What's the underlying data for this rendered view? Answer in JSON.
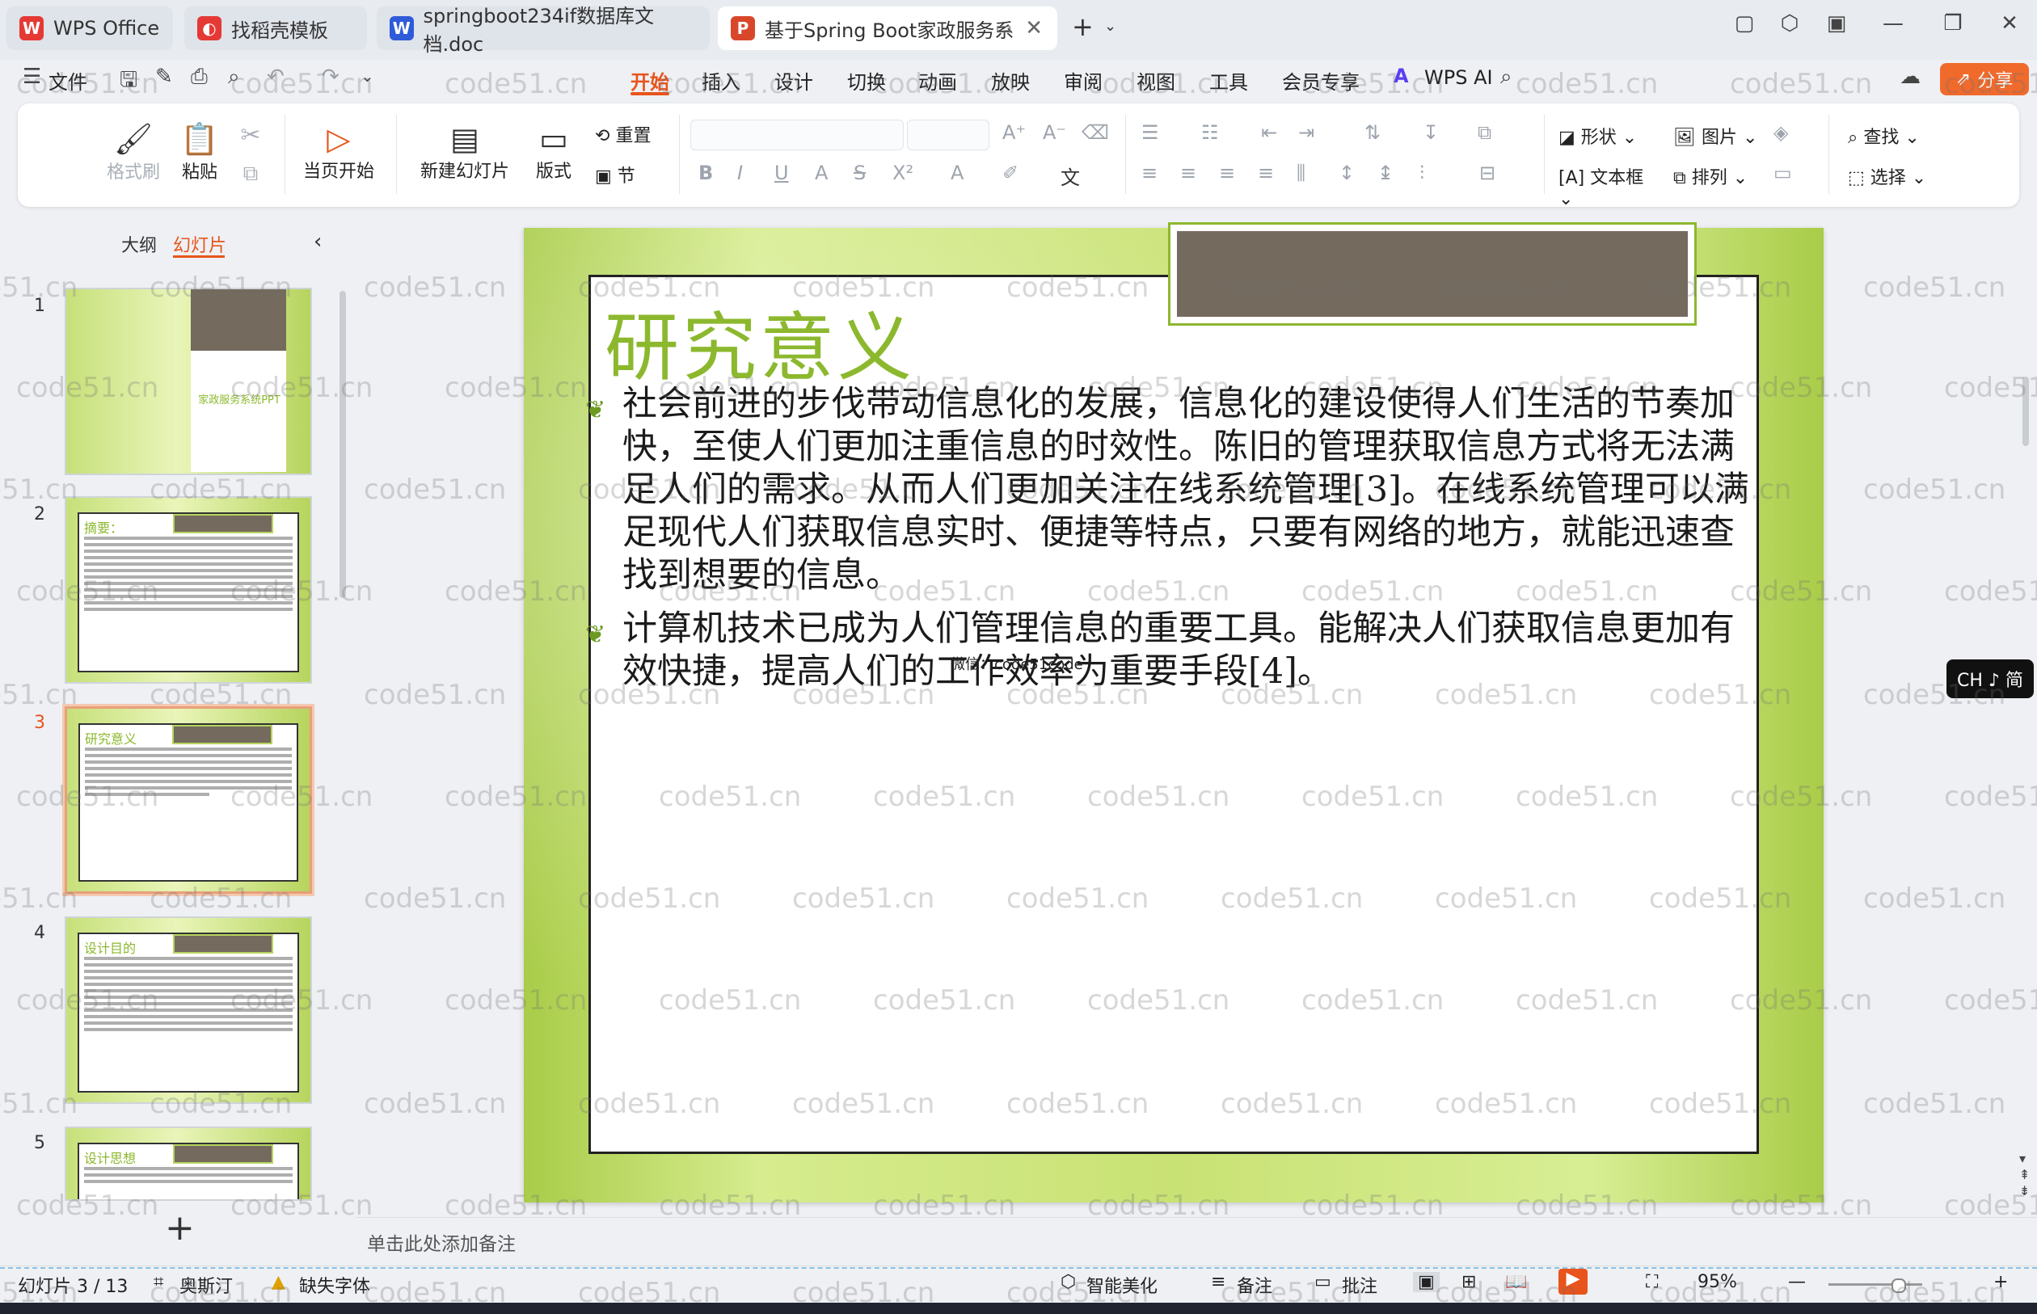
{
  "tabs": [
    {
      "label": "WPS Office",
      "icon": "wps-logo-icon",
      "color": "#e53935"
    },
    {
      "label": "找稻壳模板",
      "icon": "docer-icon",
      "color": "#e53935"
    },
    {
      "label": "springboot234if数据库文档.doc",
      "icon": "word-doc-icon",
      "color": "#2f5bd9"
    },
    {
      "label": "基于Spring Boot家政服务系",
      "icon": "ppt-icon",
      "color": "#d9472b"
    }
  ],
  "menu": {
    "file": "文件",
    "items": [
      "开始",
      "插入",
      "设计",
      "切换",
      "动画",
      "放映",
      "审阅",
      "视图",
      "工具",
      "会员专享",
      "WPS AI"
    ],
    "active": "开始",
    "share": "分享"
  },
  "ribbon": {
    "format_painter": "格式刷",
    "paste": "粘贴",
    "play_from_current": "当页开始",
    "new_slide": "新建幻灯片",
    "layout": "版式",
    "reset": "重置",
    "section": "节",
    "shape": "形状",
    "picture": "图片",
    "textbox": "文本框",
    "arrange": "排列",
    "find": "查找",
    "select": "选择"
  },
  "panel": {
    "tab_outline": "大纲",
    "tab_slides": "幻灯片",
    "slides": [
      {
        "num": "1",
        "title": "家政服务系统PPT"
      },
      {
        "num": "2",
        "title": "摘要："
      },
      {
        "num": "3",
        "title": "研究意义"
      },
      {
        "num": "4",
        "title": "设计目的"
      },
      {
        "num": "5",
        "title": "设计思想"
      }
    ]
  },
  "slide": {
    "title": "研究意义",
    "paragraphs": [
      "社会前进的步伐带动信息化的发展，信息化的建设使得人们生活的节奏加快，至使人们更加注重信息的时效性。陈旧的管理获取信息方式将无法满足人们的需求。从而人们更加关注在线系统管理[3]。在线系统管理可以满足现代人们获取信息实时、便捷等特点，只要有网络的地方，就能迅速查找到想要的信息。",
      "计算机技术已成为人们管理信息的重要工具。能解决人们获取信息更加有效快捷，提高人们的工作效率为重要手段[4]。"
    ],
    "overlay_text": "微信：code51code"
  },
  "notes_placeholder": "单击此处添加备注",
  "status": {
    "slide_counter": "幻灯片 3 / 13",
    "theme": "奥斯汀",
    "missing_font": "缺失字体",
    "beautify": "智能美化",
    "notes": "备注",
    "comments": "批注",
    "zoom": "95%"
  },
  "ime_indicator": "CH ♪ 简",
  "watermark": "code51.cn"
}
